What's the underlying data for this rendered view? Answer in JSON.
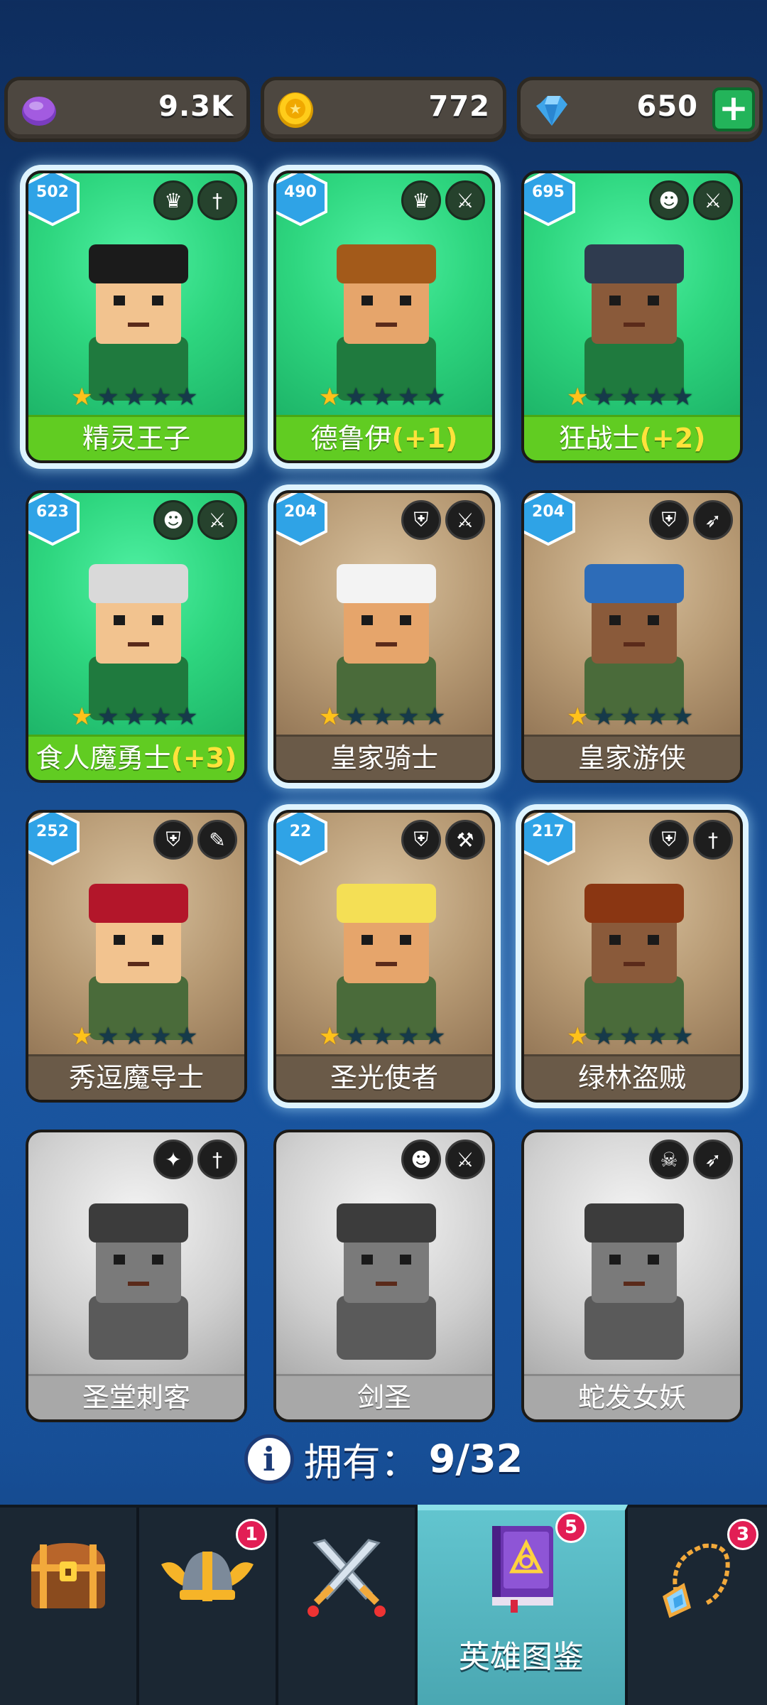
{
  "currency": {
    "elixir": "9.3K",
    "gold": "772",
    "gems": "650"
  },
  "heroes": [
    {
      "level": "502",
      "name": "精灵王子",
      "bonus": "",
      "stars": 1,
      "owned": true,
      "style": "green",
      "selected": true,
      "race_icon": "elf-race-icon",
      "class_icon": "dagger-icon"
    },
    {
      "level": "490",
      "name": "德鲁伊",
      "bonus": "(+1)",
      "stars": 1,
      "owned": true,
      "style": "green",
      "selected": true,
      "race_icon": "elf-race-icon",
      "class_icon": "sword-icon"
    },
    {
      "level": "695",
      "name": "狂战士",
      "bonus": "(+2)",
      "stars": 1,
      "owned": true,
      "style": "green",
      "selected": false,
      "race_icon": "orc-race-icon",
      "class_icon": "sword-icon"
    },
    {
      "level": "623",
      "name": "食人魔勇士",
      "bonus": "(+3)",
      "stars": 1,
      "owned": true,
      "style": "green",
      "selected": false,
      "race_icon": "orc-race-icon",
      "class_icon": "sword-icon"
    },
    {
      "level": "204",
      "name": "皇家骑士",
      "bonus": "",
      "stars": 1,
      "owned": true,
      "style": "brown",
      "selected": true,
      "race_icon": "helmet-race-icon",
      "class_icon": "sword-icon"
    },
    {
      "level": "204",
      "name": "皇家游侠",
      "bonus": "",
      "stars": 1,
      "owned": true,
      "style": "brown",
      "selected": false,
      "race_icon": "helmet-race-icon",
      "class_icon": "bow-icon"
    },
    {
      "level": "252",
      "name": "秀逗魔导士",
      "bonus": "",
      "stars": 1,
      "owned": true,
      "style": "brown",
      "selected": false,
      "race_icon": "helmet-race-icon",
      "class_icon": "wand-icon"
    },
    {
      "level": "22",
      "name": "圣光使者",
      "bonus": "",
      "stars": 1,
      "owned": true,
      "style": "brown",
      "selected": true,
      "race_icon": "helmet-race-icon",
      "class_icon": "hammer-icon"
    },
    {
      "level": "217",
      "name": "绿林盗贼",
      "bonus": "",
      "stars": 1,
      "owned": true,
      "style": "brown",
      "selected": true,
      "race_icon": "helmet-race-icon",
      "class_icon": "dagger-icon"
    },
    {
      "level": "",
      "name": "圣堂刺客",
      "bonus": "",
      "stars": 0,
      "owned": false,
      "style": "gray",
      "selected": false,
      "race_icon": "angel-race-icon",
      "class_icon": "dagger-icon"
    },
    {
      "level": "",
      "name": "剑圣",
      "bonus": "",
      "stars": 0,
      "owned": false,
      "style": "gray",
      "selected": false,
      "race_icon": "orc-race-icon",
      "class_icon": "sword-icon"
    },
    {
      "level": "",
      "name": "蛇发女妖",
      "bonus": "",
      "stars": 0,
      "owned": false,
      "style": "gray",
      "selected": false,
      "race_icon": "skull-race-icon",
      "class_icon": "bow-icon"
    }
  ],
  "owned": {
    "label": "拥有：",
    "count": "9/32"
  },
  "nav": {
    "items": [
      {
        "icon": "chest-icon",
        "label": "",
        "badge": ""
      },
      {
        "icon": "viking-helmet-icon",
        "label": "",
        "badge": "1"
      },
      {
        "icon": "crossed-swords-icon",
        "label": "",
        "badge": ""
      },
      {
        "icon": "spellbook-icon",
        "label": "英雄图鉴",
        "badge": "5"
      },
      {
        "icon": "amulet-icon",
        "label": "",
        "badge": "3"
      }
    ]
  },
  "colors": {
    "accent_green": "#61cc22",
    "bonus_yellow": "#ffe23b",
    "active_tab": "#56b8c2",
    "notif_red": "#e21e55"
  }
}
